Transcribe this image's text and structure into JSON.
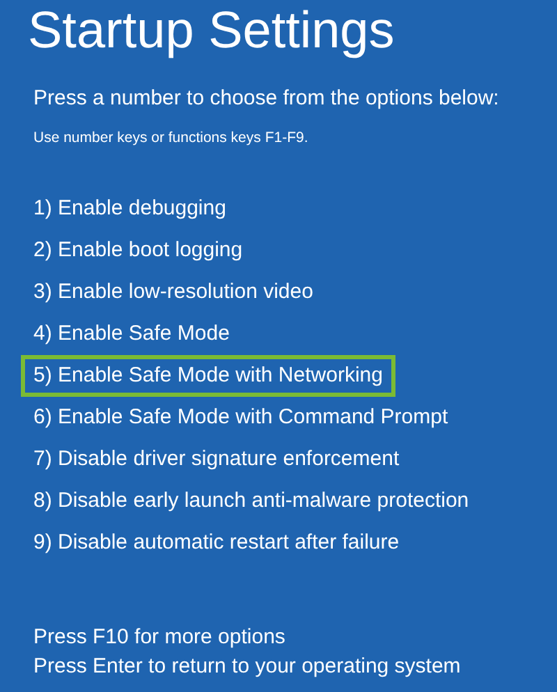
{
  "title": "Startup Settings",
  "prompt": "Press a number to choose from the options below:",
  "hint": "Use number keys or functions keys F1-F9.",
  "options": [
    {
      "label": "1) Enable debugging",
      "selected": false
    },
    {
      "label": "2) Enable boot logging",
      "selected": false
    },
    {
      "label": "3) Enable low-resolution video",
      "selected": false
    },
    {
      "label": "4) Enable Safe Mode",
      "selected": false
    },
    {
      "label": "5) Enable Safe Mode with Networking",
      "selected": true
    },
    {
      "label": "6) Enable Safe Mode with Command Prompt",
      "selected": false
    },
    {
      "label": "7) Disable driver signature enforcement",
      "selected": false
    },
    {
      "label": "8) Disable early launch anti-malware protection",
      "selected": false
    },
    {
      "label": "9) Disable automatic restart after failure",
      "selected": false
    }
  ],
  "footer": [
    "Press F10 for more options",
    "Press Enter to return to your operating system"
  ]
}
